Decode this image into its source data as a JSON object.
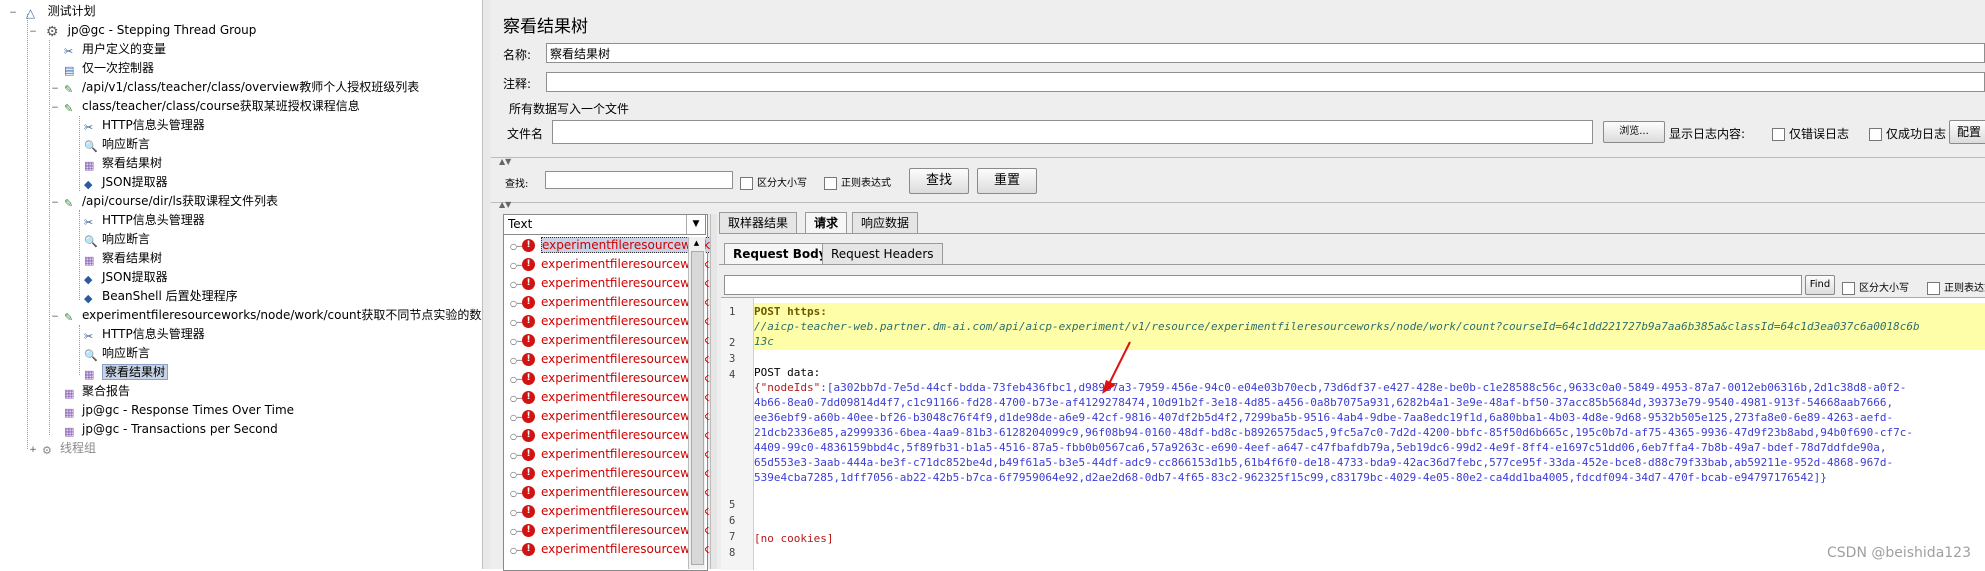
{
  "tree": {
    "root": "测试计划",
    "thread_group": "jp@gc - Stepping Thread Group",
    "items": [
      {
        "label": "用户定义的变量",
        "icon": "wrench-icon"
      },
      {
        "label": "仅一次控制器",
        "icon": "controller-icon"
      },
      {
        "label": "/api/v1/class/teacher/class/overview教师个人授权班级列表",
        "icon": "sampler-icon"
      },
      {
        "label": "class/teacher/class/course获取某班授权课程信息",
        "icon": "sampler-icon"
      },
      {
        "label": "HTTP信息头管理器",
        "icon": "wrench-icon"
      },
      {
        "label": "响应断言",
        "icon": "magnifier-icon"
      },
      {
        "label": "察看结果树",
        "icon": "listener-icon"
      },
      {
        "label": "JSON提取器",
        "icon": "extractor-icon"
      },
      {
        "label": "/api/course/dir/ls获取课程文件列表",
        "icon": "sampler-icon"
      },
      {
        "label": "HTTP信息头管理器",
        "icon": "wrench-icon"
      },
      {
        "label": "响应断言",
        "icon": "magnifier-icon"
      },
      {
        "label": "察看结果树",
        "icon": "listener-icon"
      },
      {
        "label": "JSON提取器",
        "icon": "extractor-icon"
      },
      {
        "label": "BeanShell 后置处理程序",
        "icon": "extractor-icon"
      },
      {
        "label": "experimentfileresourceworks/node/work/count获取不同节点实验的数量",
        "icon": "sampler-icon"
      },
      {
        "label": "HTTP信息头管理器",
        "icon": "wrench-icon"
      },
      {
        "label": "响应断言",
        "icon": "magnifier-icon"
      },
      {
        "label": "察看结果树",
        "icon": "listener-icon"
      },
      {
        "label": "聚合报告",
        "icon": "listener-icon"
      },
      {
        "label": "jp@gc - Response Times Over Time",
        "icon": "listener-icon"
      },
      {
        "label": "jp@gc - Transactions per Second",
        "icon": "listener-icon"
      },
      {
        "label": "线程组",
        "icon": "gear-icon"
      }
    ]
  },
  "panel": {
    "title": "察看结果树",
    "name_label": "名称:",
    "name_value": "察看结果树",
    "comment_label": "注释:",
    "write_all_label": "所有数据写入一个文件",
    "filename_label": "文件名",
    "browse_button": "浏览...",
    "log_display_label": "显示日志内容:",
    "errors_only": "仅错误日志",
    "success_only": "仅成功日志",
    "configure_button": "配置"
  },
  "search": {
    "label": "查找:",
    "case_sensitive": "区分大小写",
    "regex": "正则表达式",
    "find_button": "查找",
    "reset_button": "重置"
  },
  "results": {
    "renderer": "Text",
    "item_label": "experimentfileresourceworks",
    "item_count": 17
  },
  "tabs": {
    "sampler_result": "取样器结果",
    "request": "请求",
    "response_data": "响应数据",
    "request_body": "Request Body",
    "request_headers": "Request Headers"
  },
  "find_bar": {
    "find_button": "Find",
    "case_sensitive": "区分大小写",
    "regex": "正则表达式"
  },
  "code": {
    "line_numbers": [
      "1",
      "2",
      "3",
      "4",
      "5",
      "6",
      "7",
      "8"
    ],
    "line1": "POST https:",
    "line1b": "//aicp-teacher-web.partner.dm-ai.com/api/aicp-experiment/v1/resource/experimentfileresourceworks/node/work/count?courseId=64c1dd221727b9a7aa6b385a&classId=64c1d3ea037c6a0018c6b",
    "line1c": "13c",
    "line3": "POST data:",
    "line4_key": "{\"nodeIds\"",
    "line4_rest": ":[a302bb7d-7e5d-44cf-bdda-73feb436fbc1,d98987a3-7959-456e-94c0-e04e03b70ecb,73d6df37-e427-428e-be0b-c1e28588c56c,9633c0a0-5849-4953-87a7-0012eb06316b,2d1c38d8-a0f2-",
    "line4_b": "4b66-8ea0-7dd09814d4f7,c1c91166-fd28-4700-b73e-af4129278474,10d91b2f-3e18-4d85-a456-0a8b7075a931,6282b4a1-3e9e-48af-bf50-37acc85b5684d,39373e79-9540-4981-913f-54668aab7666,",
    "line4_c": "ee36ebf9-a60b-40ee-bf26-b3048c76f4f9,d1de98de-a6e9-42cf-9816-407df2b5d4f2,7299ba5b-9516-4ab4-9dbe-7aa8edc19f1d,6a80bba1-4b03-4d8e-9d68-9532b505e125,273fa8e0-6e89-4263-aefd-",
    "line4_d": "21dcb2336e85,a2999336-6bea-4aa9-81b3-6128204099c9,96f08b94-0160-48df-bd8c-b8926575dac5,9fc5a7c0-7d2d-4200-bbfc-85f50d6b665c,195c0b7d-af75-4365-9936-47d9f23b8abd,94b0f690-cf7c-",
    "line4_e": "4409-99c0-4836159bbd4c,5f89fb31-b1a5-4516-87a5-fbb0b0567ca6,57a9263c-e690-4eef-a647-c47fbafdb79a,5eb19dc6-99d2-4e9f-8ff4-e1697c51dd06,6eb7ffa4-7b8b-49a7-bdef-78d7ddfde90a,",
    "line4_f": "65d553e3-3aab-444a-be3f-c71dc852be4d,b49f61a5-b3e5-44df-adc9-cc866153d1b5,61b4f6f0-de18-4733-bda9-42ac36d7febc,577ce95f-33da-452e-bce8-d88c79f33bab,ab59211e-952d-4868-967d-",
    "line4_g": "539e4cba7285,1dff7056-ab22-42b5-b7ca-6f7959064e92,d2ae2d68-0db7-4f65-83c2-962325f15c99,c83179bc-4029-4e05-80e2-ca4dd1ba4005,fdcdf094-34d7-470f-bcab-e94797176542]}",
    "line7": "[no cookies]"
  },
  "watermark": "CSDN @beishida123",
  "colors": {
    "selection": "#c7d3e6",
    "error_red": "#d00000",
    "highlight_yellow": "#fffea8"
  }
}
